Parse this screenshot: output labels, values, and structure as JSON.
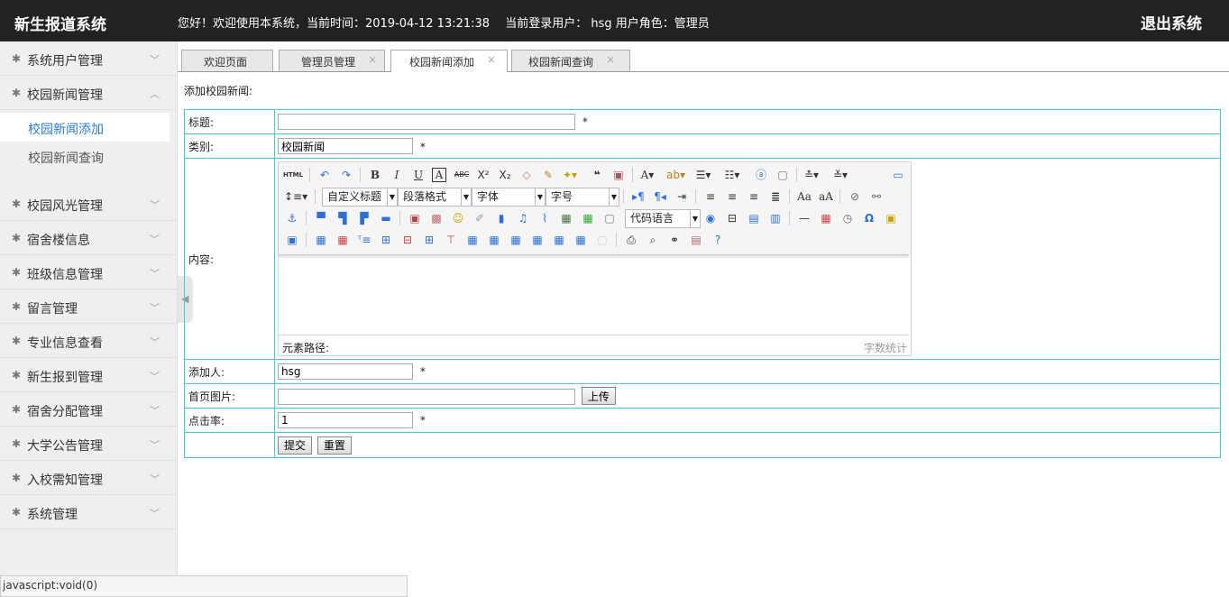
{
  "header": {
    "brand": "新生报道系统",
    "welcome": "您好！欢迎使用本系统，当前时间：2019-04-12 13:21:38　 当前登录用户： hsg  用户角色：管理员",
    "logout": "退出系统"
  },
  "sidebar": {
    "items": [
      {
        "label": "系统用户管理"
      },
      {
        "label": "校园新闻管理"
      },
      {
        "label": "校园风光管理"
      },
      {
        "label": "宿舍楼信息"
      },
      {
        "label": "班级信息管理"
      },
      {
        "label": "留言管理"
      },
      {
        "label": "专业信息查看"
      },
      {
        "label": "新生报到管理"
      },
      {
        "label": "宿舍分配管理"
      },
      {
        "label": "大学公告管理"
      },
      {
        "label": "入校需知管理"
      },
      {
        "label": "系统管理"
      }
    ],
    "subitems": [
      {
        "label": "校园新闻添加"
      },
      {
        "label": "校园新闻查询"
      }
    ]
  },
  "tabs": [
    {
      "label": "欢迎页面"
    },
    {
      "label": "管理员管理"
    },
    {
      "label": "校园新闻添加"
    },
    {
      "label": "校园新闻查询"
    }
  ],
  "form": {
    "heading": "添加校园新闻:",
    "title_label": "标题:",
    "title_value": "",
    "category_label": "类别:",
    "category_value": "校园新闻",
    "content_label": "内容:",
    "author_label": "添加人:",
    "author_value": "hsg",
    "image_label": "首页图片:",
    "image_value": "",
    "upload": "上传",
    "clicks_label": "点击率:",
    "clicks_value": "1",
    "required": "*",
    "submit": "提交",
    "reset": "重置"
  },
  "editor": {
    "html_btn": "HTML",
    "custom_title": "自定义标题",
    "paragraph": "段落格式",
    "font_family": "字体",
    "font_size": "字号",
    "code_lang": "代码语言",
    "path_label": "元素路径:",
    "word_count": "字数统计"
  },
  "status": {
    "text": "javascript:void(0)"
  }
}
